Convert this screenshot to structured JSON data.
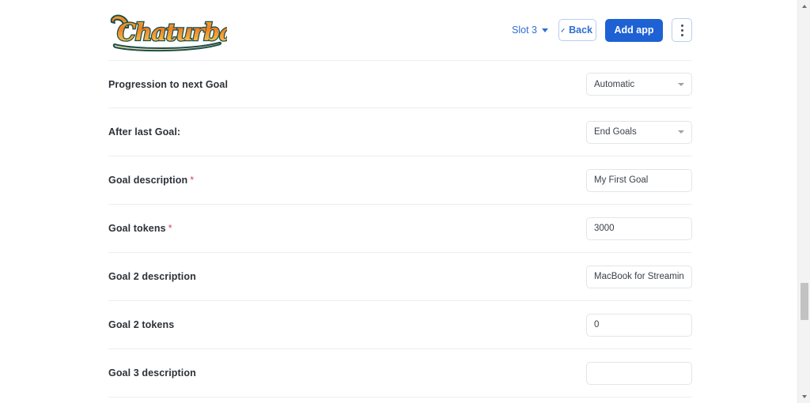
{
  "header": {
    "logo_text": "Chaturbate",
    "logo_colors": {
      "gradient_start": "#f08020",
      "gradient_end": "#f7d04a",
      "outline": "#1f4f4a",
      "swoosh": "#efdfb8"
    },
    "slot_selector": {
      "label": "Slot 3",
      "icon": "chevron-down-icon"
    },
    "back_button": {
      "label": "Back",
      "icon": "chevron-left-icon"
    },
    "add_app_button": {
      "label": "Add app",
      "color": "#1d61d4"
    },
    "kebab_button": {
      "icon": "more-vertical-icon"
    }
  },
  "form": {
    "required_marker": "*",
    "rows": [
      {
        "label": "Progression to next Goal",
        "required": false,
        "control": "select",
        "value": "Automatic",
        "placeholder": ""
      },
      {
        "label": "After last Goal:",
        "required": false,
        "control": "select",
        "value": "End Goals",
        "placeholder": ""
      },
      {
        "label": "Goal description",
        "required": true,
        "control": "text",
        "value": "My First Goal",
        "placeholder": ""
      },
      {
        "label": "Goal tokens",
        "required": true,
        "control": "text",
        "value": "3000",
        "placeholder": ""
      },
      {
        "label": "Goal 2 description",
        "required": false,
        "control": "text",
        "value": "MacBook for Streaming",
        "placeholder": ""
      },
      {
        "label": "Goal 2 tokens",
        "required": false,
        "control": "text",
        "value": "0",
        "placeholder": ""
      },
      {
        "label": "Goal 3 description",
        "required": false,
        "control": "text",
        "value": "",
        "placeholder": ""
      }
    ]
  },
  "scrollbar": {
    "up_icon": "arrow-up-icon",
    "down_icon": "arrow-down-icon"
  }
}
